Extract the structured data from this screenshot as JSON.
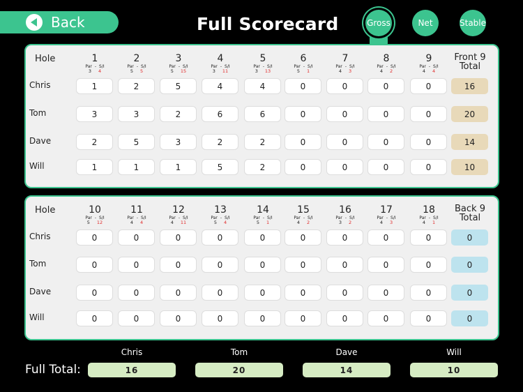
{
  "header": {
    "back_label": "Back",
    "title": "Full Scorecard",
    "modes": [
      {
        "label": "Gross",
        "active": true
      },
      {
        "label": "Net",
        "active": false
      },
      {
        "label": "Stable",
        "active": false
      }
    ]
  },
  "colors": {
    "accent": "#3cc48f",
    "front_total_bg": "#e8d9b9",
    "back_total_bg": "#bde3ee",
    "full_total_bg": "#d6ecc3",
    "stroke_index": "#e02a2a"
  },
  "labels": {
    "hole": "Hole",
    "par": "Par",
    "dash": "-",
    "si": "S/I",
    "front_total_line1": "Front 9",
    "front_total_line2": "Total",
    "back_total_line1": "Back 9",
    "back_total_line2": "Total",
    "full_total": "Full Total:"
  },
  "front_nine": {
    "holes": [
      {
        "num": "1",
        "par": "3",
        "si": "4"
      },
      {
        "num": "2",
        "par": "5",
        "si": "5"
      },
      {
        "num": "3",
        "par": "5",
        "si": "15"
      },
      {
        "num": "4",
        "par": "3",
        "si": "11"
      },
      {
        "num": "5",
        "par": "3",
        "si": "13"
      },
      {
        "num": "6",
        "par": "5",
        "si": "1"
      },
      {
        "num": "7",
        "par": "4",
        "si": "3"
      },
      {
        "num": "8",
        "par": "4",
        "si": "2"
      },
      {
        "num": "9",
        "par": "4",
        "si": "4"
      }
    ],
    "players": [
      {
        "name": "Chris",
        "scores": [
          "1",
          "2",
          "5",
          "4",
          "4",
          "0",
          "0",
          "0",
          "0"
        ],
        "total": "16"
      },
      {
        "name": "Tom",
        "scores": [
          "3",
          "3",
          "2",
          "6",
          "6",
          "0",
          "0",
          "0",
          "0"
        ],
        "total": "20"
      },
      {
        "name": "Dave",
        "scores": [
          "2",
          "5",
          "3",
          "2",
          "2",
          "0",
          "0",
          "0",
          "0"
        ],
        "total": "14"
      },
      {
        "name": "Will",
        "scores": [
          "1",
          "1",
          "1",
          "5",
          "2",
          "0",
          "0",
          "0",
          "0"
        ],
        "total": "10"
      }
    ]
  },
  "back_nine": {
    "holes": [
      {
        "num": "10",
        "par": "5",
        "si": "12"
      },
      {
        "num": "11",
        "par": "4",
        "si": "4"
      },
      {
        "num": "12",
        "par": "4",
        "si": "11"
      },
      {
        "num": "13",
        "par": "5",
        "si": "4"
      },
      {
        "num": "14",
        "par": "5",
        "si": "1"
      },
      {
        "num": "15",
        "par": "4",
        "si": "2"
      },
      {
        "num": "16",
        "par": "3",
        "si": "2"
      },
      {
        "num": "17",
        "par": "4",
        "si": "3"
      },
      {
        "num": "18",
        "par": "4",
        "si": "1"
      }
    ],
    "players": [
      {
        "name": "Chris",
        "scores": [
          "0",
          "0",
          "0",
          "0",
          "0",
          "0",
          "0",
          "0",
          "0"
        ],
        "total": "0"
      },
      {
        "name": "Tom",
        "scores": [
          "0",
          "0",
          "0",
          "0",
          "0",
          "0",
          "0",
          "0",
          "0"
        ],
        "total": "0"
      },
      {
        "name": "Dave",
        "scores": [
          "0",
          "0",
          "0",
          "0",
          "0",
          "0",
          "0",
          "0",
          "0"
        ],
        "total": "0"
      },
      {
        "name": "Will",
        "scores": [
          "0",
          "0",
          "0",
          "0",
          "0",
          "0",
          "0",
          "0",
          "0"
        ],
        "total": "0"
      }
    ]
  },
  "full_totals": [
    {
      "name": "Chris",
      "total": "16"
    },
    {
      "name": "Tom",
      "total": "20"
    },
    {
      "name": "Dave",
      "total": "14"
    },
    {
      "name": "Will",
      "total": "10"
    }
  ]
}
